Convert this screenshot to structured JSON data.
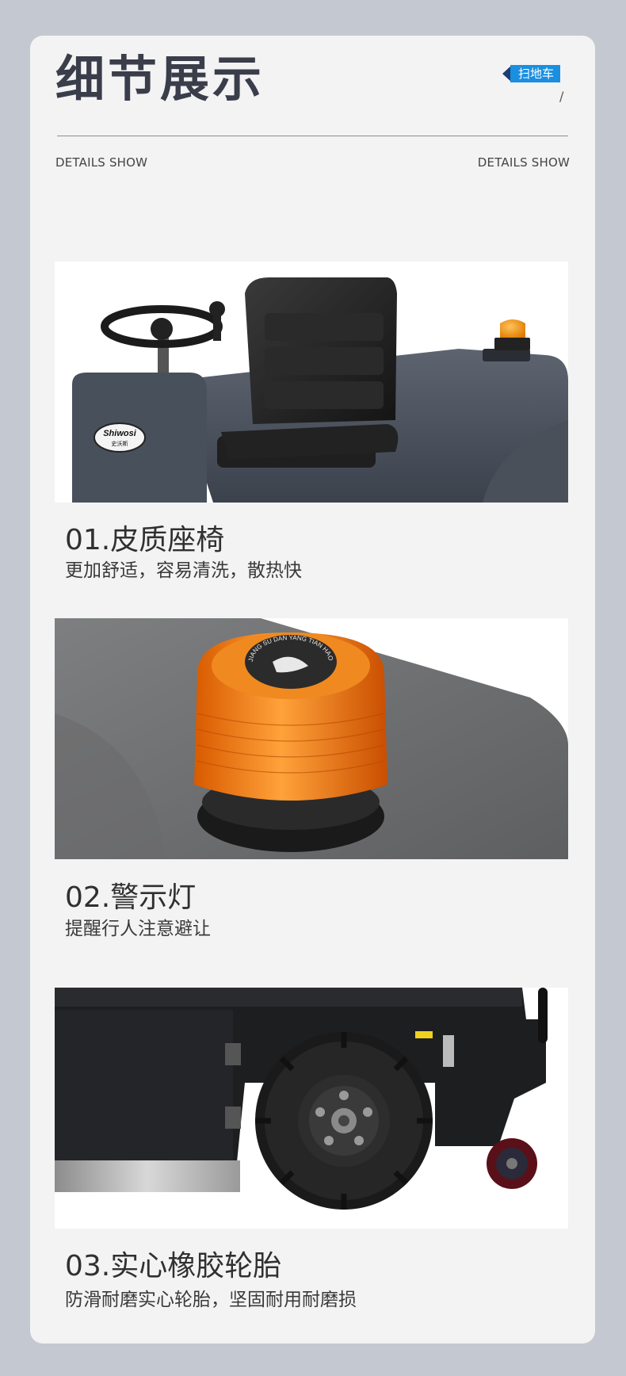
{
  "header": {
    "title": "细节展示",
    "tag": "扫地车",
    "slash": "/",
    "subtitle_left": "DETAILS SHOW",
    "subtitle_right": "DETAILS SHOW"
  },
  "sections": [
    {
      "title": "01.皮质座椅",
      "desc": "更加舒适，容易清洗，散热快",
      "logo_text": "Shiwosi",
      "logo_sub": "史沃斯"
    },
    {
      "title": "02.警示灯",
      "desc": "提醒行人注意避让",
      "lamp_text": "JIANG SU DAN YANG TIAN HAO COMPANY"
    },
    {
      "title": "03.实心橡胶轮胎",
      "desc": "防滑耐磨实心轮胎，坚固耐用耐磨损"
    }
  ]
}
